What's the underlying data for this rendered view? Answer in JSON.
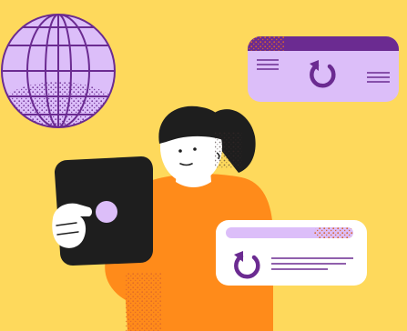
{
  "colors": {
    "background": "#FED95C",
    "globe": "#DCBEF9",
    "globe_lines": "#6B2B91",
    "card_header": "#6B2B91",
    "card_body": "#DCBEF9",
    "card_white": "#FFFFFF",
    "shirt": "#FF8B1A",
    "hair": "#1E1E1E",
    "skin": "#FFFFFF",
    "tablet": "#1E1E1E",
    "tablet_button": "#DCBEF9",
    "refresh_icon": "#6B2B91",
    "stipple": "#D9652A"
  },
  "icons": {
    "globe": "globe-icon",
    "refresh": "refresh-icon",
    "menu_lines": "hamburger-lines-icon"
  }
}
